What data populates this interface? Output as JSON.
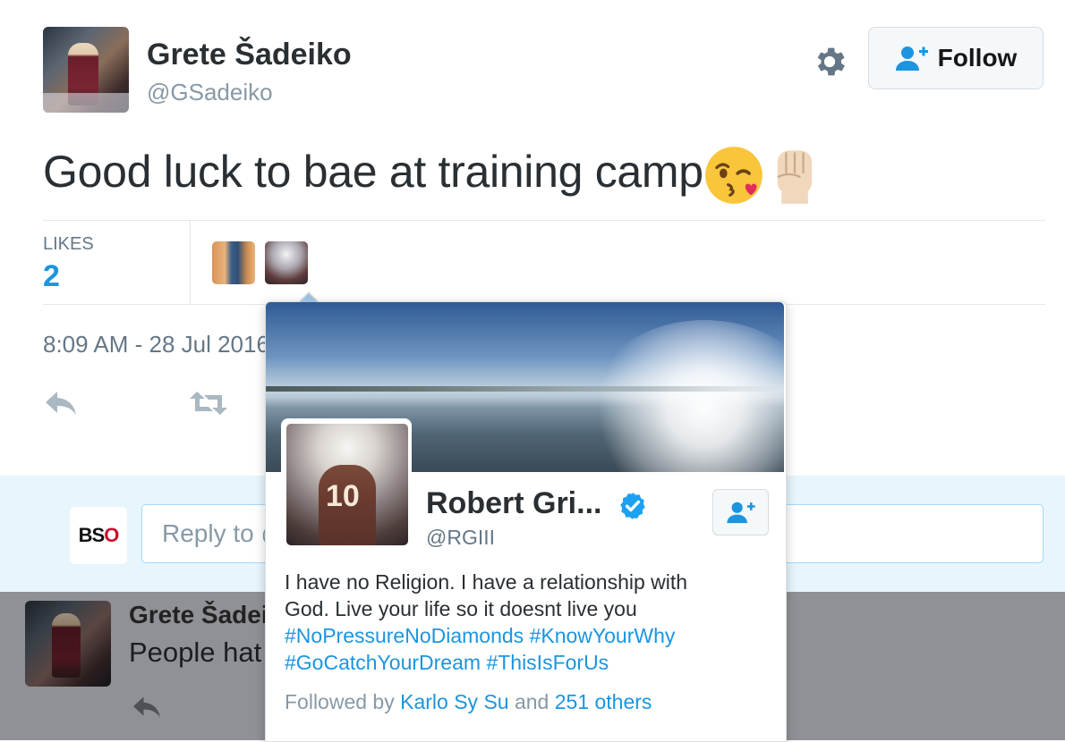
{
  "tweet": {
    "author_name": "Grete Šadeiko",
    "author_handle": "@GSadeiko",
    "follow_label": "Follow",
    "text": "Good luck to bae at training camp",
    "emojis": [
      "kissing-face-with-heart-emoji",
      "raised-fist-emoji"
    ],
    "likes_label": "LIKES",
    "likes_count": "2",
    "timestamp": "8:09 AM - 28 Jul 2016"
  },
  "composer": {
    "placeholder": "Reply to @GSadeiko",
    "avatar_text_b": "BS",
    "avatar_text_o": "O"
  },
  "reply": {
    "author_name": "Grete Šadeiko",
    "text": "People hat"
  },
  "hover_card": {
    "name": "Robert Gri...",
    "handle": "@RGIII",
    "jersey_number": "10",
    "bio_line1": "I have no Religion. I have a relationship with",
    "bio_line2": "God. Live your life so it doesnt live you",
    "hashtags": [
      "#NoPressureNoDiamonds",
      "#KnowYourWhy",
      "#GoCatchYourDream",
      "#ThisIsForUs"
    ],
    "followed_prefix": "Followed by",
    "followed_user": "Karlo Sy Su",
    "followed_and": "and",
    "followed_others": "251 others"
  },
  "colors": {
    "link_blue": "#1b95e0",
    "composer_bg": "#e8f5fd",
    "text_dark": "#292f33",
    "text_muted": "#657786"
  }
}
